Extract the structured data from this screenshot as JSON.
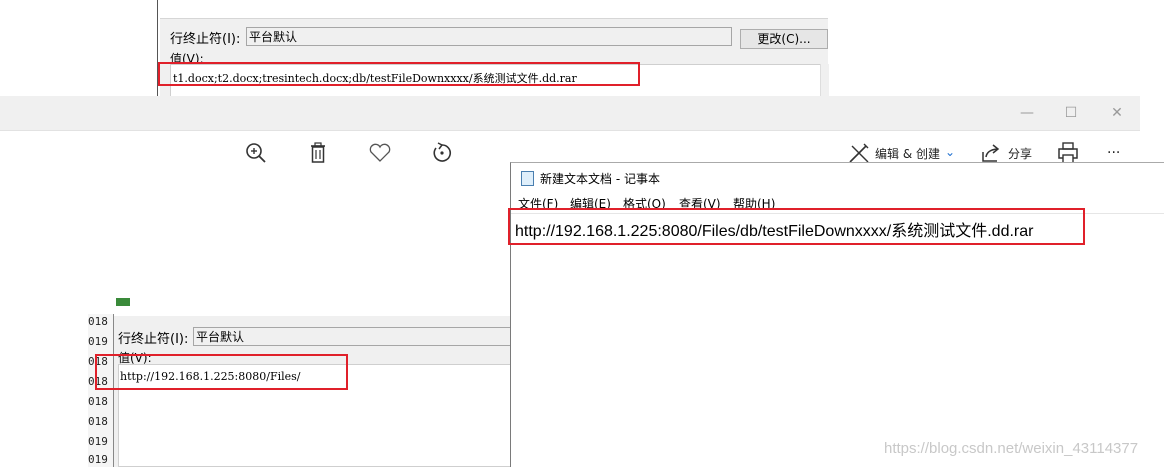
{
  "top_dialog": {
    "eol_label": "行终止符(I):",
    "eol_value": "平台默认",
    "change_button": "更改(C)...",
    "value_label": "值(V):",
    "value_text": "t1.docx;t2.docx;tresintech.docx;db/testFileDownxxxx/系统测试文件.dd.rar"
  },
  "photos": {
    "window_controls": {
      "minimize": "—",
      "maximize": "☐",
      "close": "✕"
    },
    "toolbar": {
      "icons": [
        "zoom-in-icon",
        "delete-icon",
        "heart-icon",
        "rotate-icon",
        "edit-create-icon",
        "share-icon",
        "print-icon",
        "more-icon"
      ],
      "edit_create_label": "编辑 & 创建",
      "share_label": "分享",
      "more_label": "···"
    }
  },
  "bottom_dialog": {
    "gutter_numbers": [
      "018",
      "019",
      "018",
      "018",
      "018",
      "018",
      "019",
      "019"
    ],
    "eol_label": "行终止符(I):",
    "eol_value": "平台默认",
    "value_label": "值(V):",
    "value_text": "http://192.168.1.225:8080/Files/"
  },
  "notepad": {
    "title": "新建文本文档 - 记事本",
    "menu": [
      "文件(F)",
      "编辑(E)",
      "格式(O)",
      "查看(V)",
      "帮助(H)"
    ],
    "content": "http://192.168.1.225:8080/Files/db/testFileDownxxxx/系统测试文件.dd.rar"
  },
  "watermark": "https://blog.csdn.net/weixin_43114377",
  "colors": {
    "highlight": "#e0202a",
    "accent": "#1e6fd0"
  }
}
